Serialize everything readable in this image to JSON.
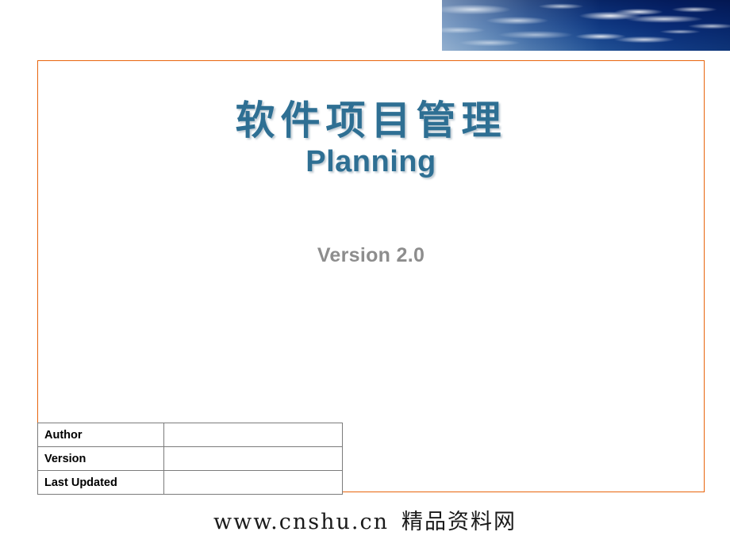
{
  "slide": {
    "background_color": "#ffffff",
    "frame_color": "#E8650D",
    "accent_color": "#2E6F93"
  },
  "banner": {
    "name": "sky-clouds-photo",
    "alt": "blue sky with clouds"
  },
  "title": {
    "chinese": "软件项目管理",
    "english": "Planning",
    "color": "#2E6F93"
  },
  "version": {
    "label": "Version 2.0",
    "color": "#8d8d8d"
  },
  "meta_table": {
    "rows": [
      {
        "label": "Author",
        "value": ""
      },
      {
        "label": "Version",
        "value": ""
      },
      {
        "label": "Last Updated",
        "value": ""
      }
    ]
  },
  "footer": {
    "url": "www.cnshu.cn",
    "site_name": "精品资料网"
  }
}
